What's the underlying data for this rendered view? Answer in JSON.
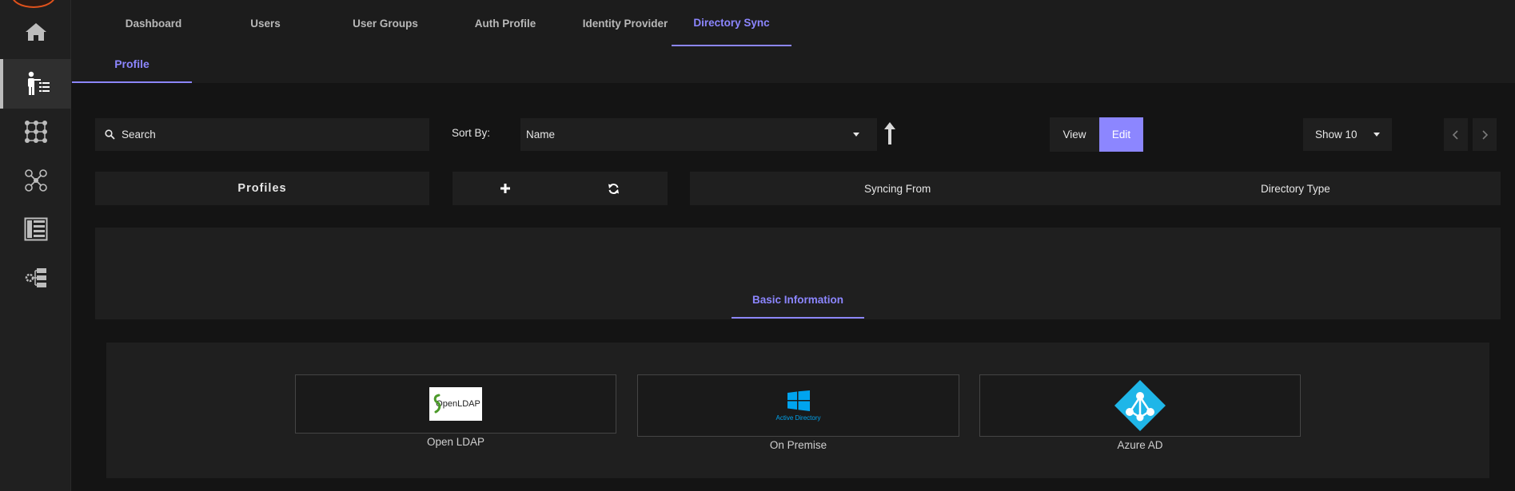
{
  "sidebar": {
    "items": [
      {
        "name": "home-icon"
      },
      {
        "name": "directory-users-icon",
        "active": true
      },
      {
        "name": "grid-nodes-icon"
      },
      {
        "name": "user-network-icon"
      },
      {
        "name": "list-layout-icon"
      },
      {
        "name": "settings-tree-icon"
      }
    ]
  },
  "topnav": {
    "tabs": [
      "Dashboard",
      "Users",
      "User Groups",
      "Auth Profile",
      "Identity Provider",
      "Directory Sync"
    ],
    "active": "Directory Sync"
  },
  "subnav": {
    "tab": "Profile"
  },
  "toolbar": {
    "search_placeholder": "Search",
    "sort_label": "Sort By:",
    "sort_value": "Name",
    "view_label": "View",
    "edit_label": "Edit",
    "show_value": "Show 10"
  },
  "table": {
    "profiles_header": "Profiles",
    "columns": [
      "Syncing From",
      "Directory Type"
    ]
  },
  "content": {
    "section_tab": "Basic Information",
    "options": [
      {
        "label": "Open LDAP",
        "logo_text": "OpenLDAP",
        "icon": "openldap-logo"
      },
      {
        "label": "On Premise",
        "logo_text": "Active Directory",
        "icon": "windows-logo"
      },
      {
        "label": "Azure AD",
        "logo_text": "",
        "icon": "azure-ad-logo"
      }
    ]
  },
  "colors": {
    "accent": "#8c86ff",
    "background": "#141414",
    "panel": "#1f1f1f",
    "azure": "#1fb6e8",
    "windows": "#00a4ef"
  }
}
